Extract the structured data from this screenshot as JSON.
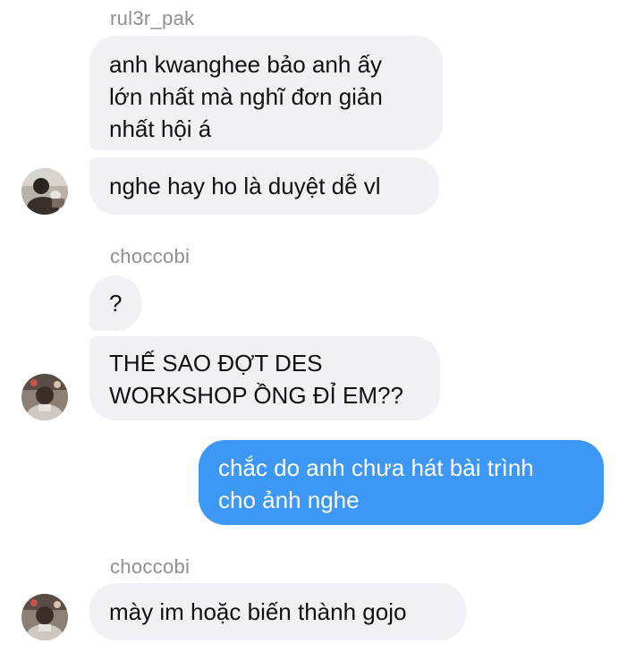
{
  "conversation": {
    "group1": {
      "sender": "rul3r_pak",
      "msg1": [
        "anh kwanghee bảo anh ấy",
        "lớn nhất mà nghĩ đơn giản",
        "nhất hội á"
      ],
      "msg2": "nghe hay ho là duyệt dễ vl",
      "avatar_icon": "user-avatar-photo"
    },
    "group2": {
      "sender": "choccobi",
      "msg1": "?",
      "msg2": [
        "THẾ SAO ĐỢT DES",
        "WORKSHOP ỒNG ĐỈ EM??"
      ],
      "avatar_icon": "user-avatar-photo"
    },
    "outgoing": {
      "msg": [
        "chắc do anh chưa hát bài trình",
        "cho ảnh nghe"
      ]
    },
    "group3": {
      "sender": "choccobi",
      "msg": "mày im hoặc biến thành gojo",
      "avatar_icon": "user-avatar-photo"
    }
  },
  "colors": {
    "incoming_bubble": "#f0f0f5",
    "outgoing_bubble": "#3d97f4",
    "sender_text": "#8e8e93"
  }
}
